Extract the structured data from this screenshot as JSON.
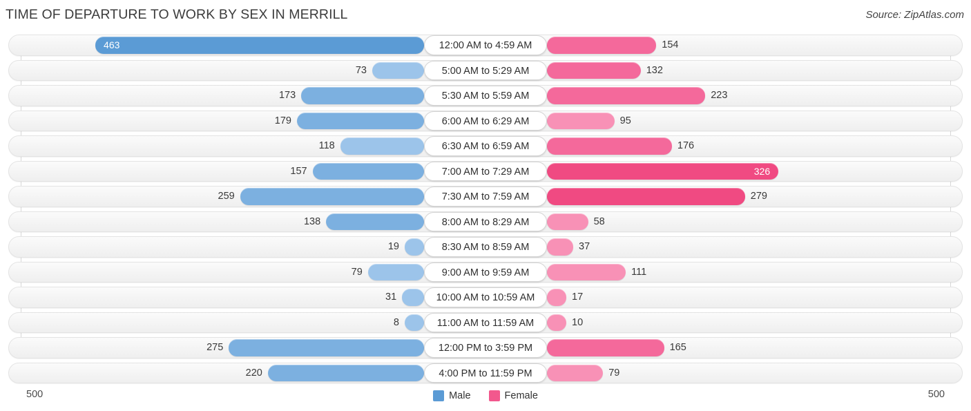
{
  "header": {
    "title": "TIME OF DEPARTURE TO WORK BY SEX IN MERRILL",
    "source": "Source: ZipAtlas.com"
  },
  "axis": {
    "left_max_label": "500",
    "right_max_label": "500",
    "max": 500
  },
  "legend": {
    "items": [
      {
        "label": "Male",
        "color": "#5b9bd5"
      },
      {
        "label": "Female",
        "color": "#f2588d"
      }
    ]
  },
  "colors": {
    "male_dark": "#5b9bd5",
    "male_mid": "#7cb0e0",
    "male_light": "#9cc4ea",
    "female_dark": "#f04a82",
    "female_mid": "#f4699b",
    "female_light": "#f891b6",
    "track": "#f2f2f2",
    "gridline": "#d8d8d8",
    "text": "#3a3a3a"
  },
  "chart_data": {
    "type": "bar",
    "title": "TIME OF DEPARTURE TO WORK BY SEX IN MERRILL",
    "subtitle": "Source: ZipAtlas.com",
    "orientation": "horizontal-diverging",
    "xlabel": "",
    "ylabel": "",
    "xlim": [
      0,
      500
    ],
    "grid": true,
    "legend_position": "bottom-center",
    "categories": [
      "12:00 AM to 4:59 AM",
      "5:00 AM to 5:29 AM",
      "5:30 AM to 5:59 AM",
      "6:00 AM to 6:29 AM",
      "6:30 AM to 6:59 AM",
      "7:00 AM to 7:29 AM",
      "7:30 AM to 7:59 AM",
      "8:00 AM to 8:29 AM",
      "8:30 AM to 8:59 AM",
      "9:00 AM to 9:59 AM",
      "10:00 AM to 10:59 AM",
      "11:00 AM to 11:59 AM",
      "12:00 PM to 3:59 PM",
      "4:00 PM to 11:59 PM"
    ],
    "series": [
      {
        "name": "Male",
        "side": "left",
        "values": [
          463,
          73,
          173,
          179,
          118,
          157,
          259,
          138,
          19,
          79,
          31,
          8,
          275,
          220
        ]
      },
      {
        "name": "Female",
        "side": "right",
        "values": [
          154,
          132,
          223,
          95,
          176,
          326,
          279,
          58,
          37,
          111,
          17,
          10,
          165,
          79
        ]
      }
    ]
  },
  "rows": [
    {
      "category": "12:00 AM to 4:59 AM",
      "male": "463",
      "female": "154",
      "male_inside": true,
      "female_inside": false
    },
    {
      "category": "5:00 AM to 5:29 AM",
      "male": "73",
      "female": "132",
      "male_inside": false,
      "female_inside": false
    },
    {
      "category": "5:30 AM to 5:59 AM",
      "male": "173",
      "female": "223",
      "male_inside": false,
      "female_inside": false
    },
    {
      "category": "6:00 AM to 6:29 AM",
      "male": "179",
      "female": "95",
      "male_inside": false,
      "female_inside": false
    },
    {
      "category": "6:30 AM to 6:59 AM",
      "male": "118",
      "female": "176",
      "male_inside": false,
      "female_inside": false
    },
    {
      "category": "7:00 AM to 7:29 AM",
      "male": "157",
      "female": "326",
      "male_inside": false,
      "female_inside": true
    },
    {
      "category": "7:30 AM to 7:59 AM",
      "male": "259",
      "female": "279",
      "male_inside": false,
      "female_inside": false
    },
    {
      "category": "8:00 AM to 8:29 AM",
      "male": "138",
      "female": "58",
      "male_inside": false,
      "female_inside": false
    },
    {
      "category": "8:30 AM to 8:59 AM",
      "male": "19",
      "female": "37",
      "male_inside": false,
      "female_inside": false
    },
    {
      "category": "9:00 AM to 9:59 AM",
      "male": "79",
      "female": "111",
      "male_inside": false,
      "female_inside": false
    },
    {
      "category": "10:00 AM to 10:59 AM",
      "male": "31",
      "female": "17",
      "male_inside": false,
      "female_inside": false
    },
    {
      "category": "11:00 AM to 11:59 AM",
      "male": "8",
      "female": "10",
      "male_inside": false,
      "female_inside": false
    },
    {
      "category": "12:00 PM to 3:59 PM",
      "male": "275",
      "female": "165",
      "male_inside": false,
      "female_inside": false
    },
    {
      "category": "4:00 PM to 11:59 PM",
      "male": "220",
      "female": "79",
      "male_inside": false,
      "female_inside": false
    }
  ]
}
